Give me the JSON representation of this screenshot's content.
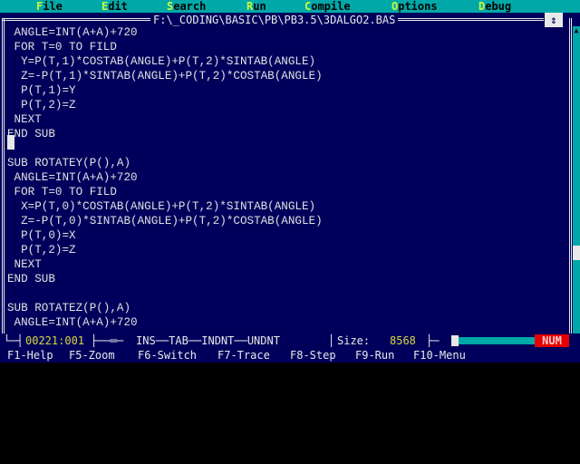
{
  "menu": {
    "items": [
      {
        "hotkey": "F",
        "rest": "ile"
      },
      {
        "hotkey": "E",
        "rest": "dit"
      },
      {
        "hotkey": "S",
        "rest": "earch"
      },
      {
        "hotkey": "R",
        "rest": "un"
      },
      {
        "hotkey": "C",
        "rest": "ompile"
      },
      {
        "hotkey": "O",
        "rest": "ptions"
      },
      {
        "hotkey": "D",
        "rest": "ebug"
      }
    ]
  },
  "window": {
    "title": "F:\\_CODING\\BASIC\\PB\\PB3.5\\3DALGO2.BAS",
    "zoom_glyph": "⇕"
  },
  "code_lines": [
    " ANGLE=INT(A+A)+720",
    " FOR T=0 TO FILD",
    "  Y=P(T,1)*COSTAB(ANGLE)+P(T,2)*SINTAB(ANGLE)",
    "  Z=-P(T,1)*SINTAB(ANGLE)+P(T,2)*COSTAB(ANGLE)",
    "  P(T,1)=Y",
    "  P(T,2)=Z",
    " NEXT",
    "END SUB",
    "",
    "SUB ROTATEY(P(),A)",
    " ANGLE=INT(A+A)+720",
    " FOR T=0 TO FILD",
    "  X=P(T,0)*COSTAB(ANGLE)+P(T,2)*SINTAB(ANGLE)",
    "  Z=-P(T,0)*SINTAB(ANGLE)+P(T,2)*COSTAB(ANGLE)",
    "  P(T,0)=X",
    "  P(T,2)=Z",
    " NEXT",
    "END SUB",
    "",
    "SUB ROTATEZ(P(),A)",
    " ANGLE=INT(A+A)+720"
  ],
  "status": {
    "position": "00221:001",
    "flags": "INS──TAB──INDNT──UNDNT",
    "size_label": "Size:",
    "size_value": "8568",
    "num": "NUM"
  },
  "fkeys": [
    "F1-Help",
    "F5-Zoom",
    "F6-Switch",
    "F7-Trace",
    "F8-Step",
    "F9-Run",
    "F10-Menu"
  ],
  "colors": {
    "menu_bg": "#00a8a8",
    "editor_bg": "#00005c",
    "hotkey": "#c8fc3c",
    "text": "#e0e0e0"
  }
}
